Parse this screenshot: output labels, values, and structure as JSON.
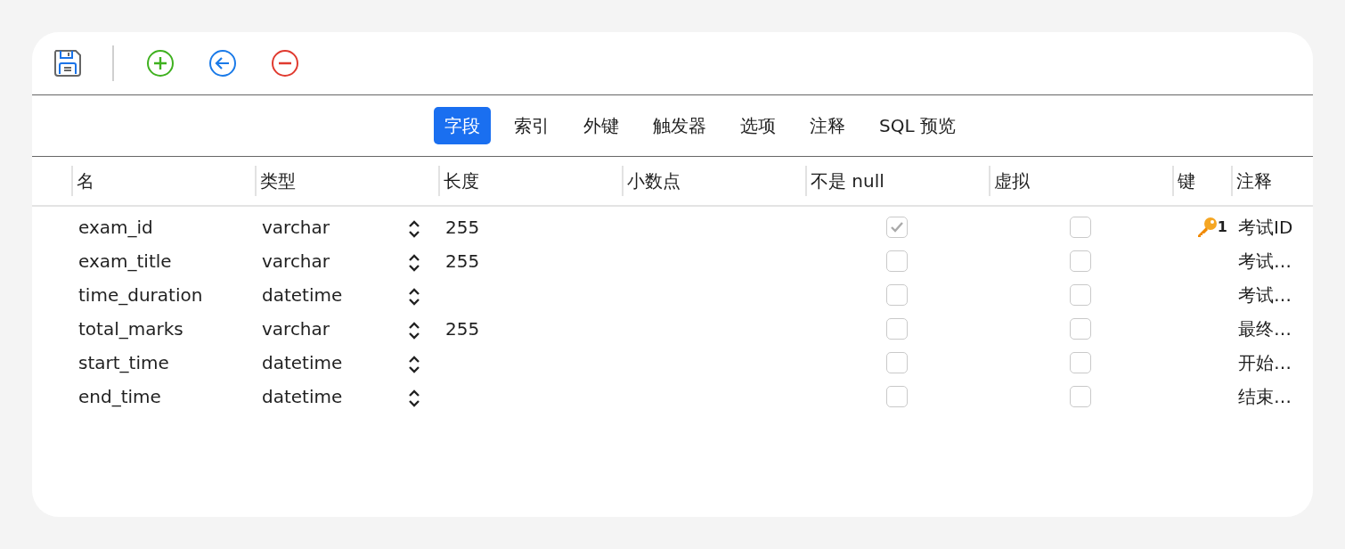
{
  "toolbar": [
    {
      "kind": "save"
    },
    {
      "kind": "add"
    },
    {
      "kind": "back"
    },
    {
      "kind": "remove"
    }
  ],
  "tabs": [
    {
      "label": "字段",
      "selected": true
    },
    {
      "label": "索引",
      "selected": false
    },
    {
      "label": "外键",
      "selected": false
    },
    {
      "label": "触发器",
      "selected": false
    },
    {
      "label": "选项",
      "selected": false
    },
    {
      "label": "注释",
      "selected": false
    },
    {
      "label": "SQL 预览",
      "selected": false
    }
  ],
  "table": {
    "columns": [
      "名",
      "类型",
      "长度",
      "小数点",
      "不是 null",
      "虚拟",
      "键",
      "注释"
    ],
    "rows": [
      {
        "name": "exam_id",
        "type": "varchar",
        "length": "255",
        "not_null": true,
        "virtual": false,
        "key": "1",
        "comment": "考试ID"
      },
      {
        "name": "exam_title",
        "type": "varchar",
        "length": "255",
        "not_null": false,
        "virtual": false,
        "comment": "考试…"
      },
      {
        "name": "time_duration",
        "type": "datetime",
        "not_null": false,
        "virtual": false,
        "comment": "考试…"
      },
      {
        "name": "total_marks",
        "type": "varchar",
        "length": "255",
        "not_null": false,
        "virtual": false,
        "comment": "最终…"
      },
      {
        "name": "start_time",
        "type": "datetime",
        "not_null": false,
        "virtual": false,
        "comment": "开始…"
      },
      {
        "name": "end_time",
        "type": "datetime",
        "not_null": false,
        "virtual": false,
        "comment": "结束…"
      }
    ]
  }
}
